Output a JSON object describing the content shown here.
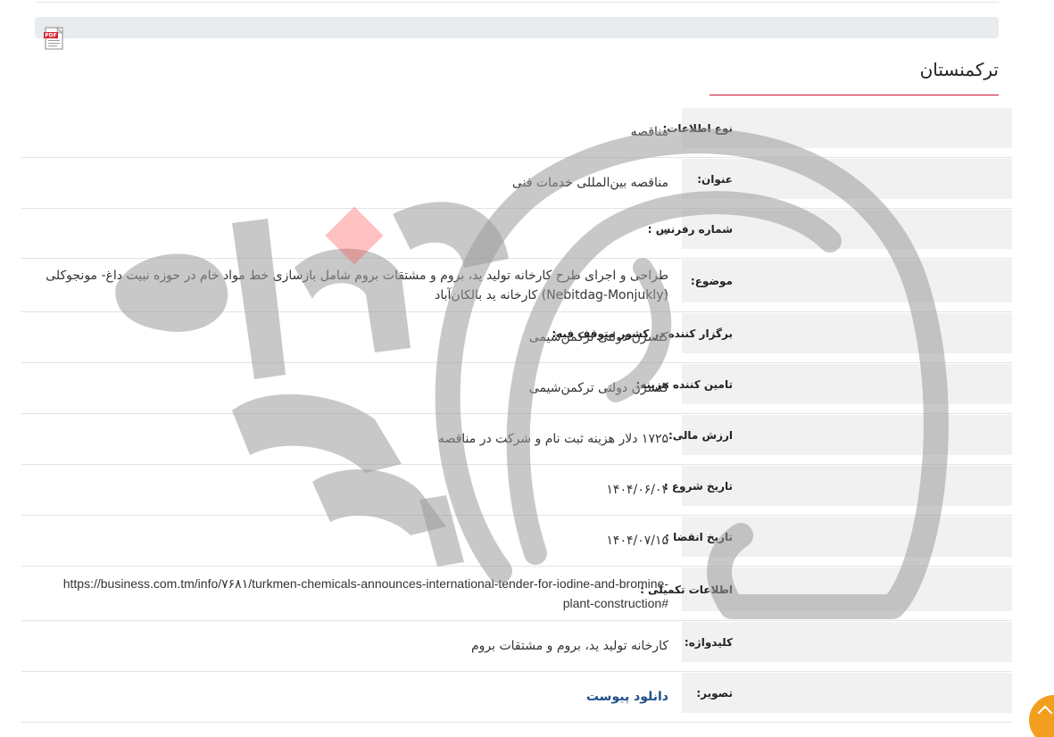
{
  "page": {
    "title": "ترکمنستان",
    "pdf_icon": "pdf-file-icon",
    "accent_color": "#c8102e",
    "scroll_button_color": "#f29f1f"
  },
  "details": [
    {
      "label": "نوع اطلاعات:",
      "value": "مناقصه"
    },
    {
      "label": "عنوان:",
      "value": "مناقصه بین‌المللی خدمات فنی"
    },
    {
      "label": "شماره رفرنس :",
      "value": "--"
    },
    {
      "label": "موضوع:",
      "value": "طراحی و اجرای طرح کارخانه تولید ید، بروم و مشتقات بروم شامل بازسازی خط مواد خام در حوزه نبیت داغ- مونجوکلی (Nebitdag-Monjukly) کارخانه ید بالکان‌آباد"
    },
    {
      "label": "برگزار کننده در کشور متوقف فیه:",
      "value": "کنسرن دولتی ترکمن‌شیمی"
    },
    {
      "label": "تامین کننده هزینه:",
      "value": "کنسرن دولتی ترکمن‌شیمی"
    },
    {
      "label": "ارزش مالی:",
      "value": "۱۷۲۵ دلار هزینه ثبت نام و شرکت در مناقصه"
    },
    {
      "label": "تاریخ شروع :",
      "value": "۱۴۰۴/۰۶/۰۴"
    },
    {
      "label": "تاریخ انقضا :",
      "value": "۱۴۰۴/۰۷/۱۵"
    },
    {
      "label": "اطلاعات تکمیلی :",
      "value": "https://business.com.tm/info/۷۶۸۱/turkmen-chemicals-announces-international-tender-for-iodine-and-bromine-plant-construction#"
    },
    {
      "label": "کلیدواژه:",
      "value": "کارخانه تولید ید، بروم و مشتقات بروم"
    },
    {
      "label": "تصویر:",
      "value": "دانلود پیوست"
    }
  ],
  "scroll_top_icon": "chevron-up-icon"
}
